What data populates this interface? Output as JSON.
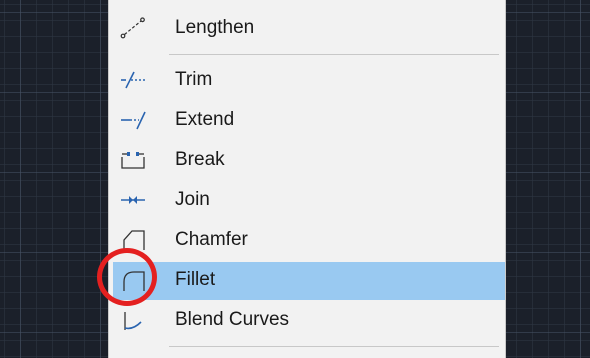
{
  "menu": {
    "items": [
      {
        "label": "Lengthen",
        "icon": "lengthen-icon"
      },
      {
        "label": "Trim",
        "icon": "trim-icon"
      },
      {
        "label": "Extend",
        "icon": "extend-icon"
      },
      {
        "label": "Break",
        "icon": "break-icon"
      },
      {
        "label": "Join",
        "icon": "join-icon"
      },
      {
        "label": "Chamfer",
        "icon": "chamfer-icon"
      },
      {
        "label": "Fillet",
        "icon": "fillet-icon",
        "highlighted": true
      },
      {
        "label": "Blend Curves",
        "icon": "blend-curves-icon"
      }
    ]
  },
  "annotation": {
    "type": "circle",
    "target": "Fillet",
    "color": "#e42020"
  },
  "colors": {
    "menu_background": "#f2f2f2",
    "highlight_background": "#99c9f1",
    "canvas_background": "#1b202a",
    "icon_blue": "#2a64b0"
  }
}
